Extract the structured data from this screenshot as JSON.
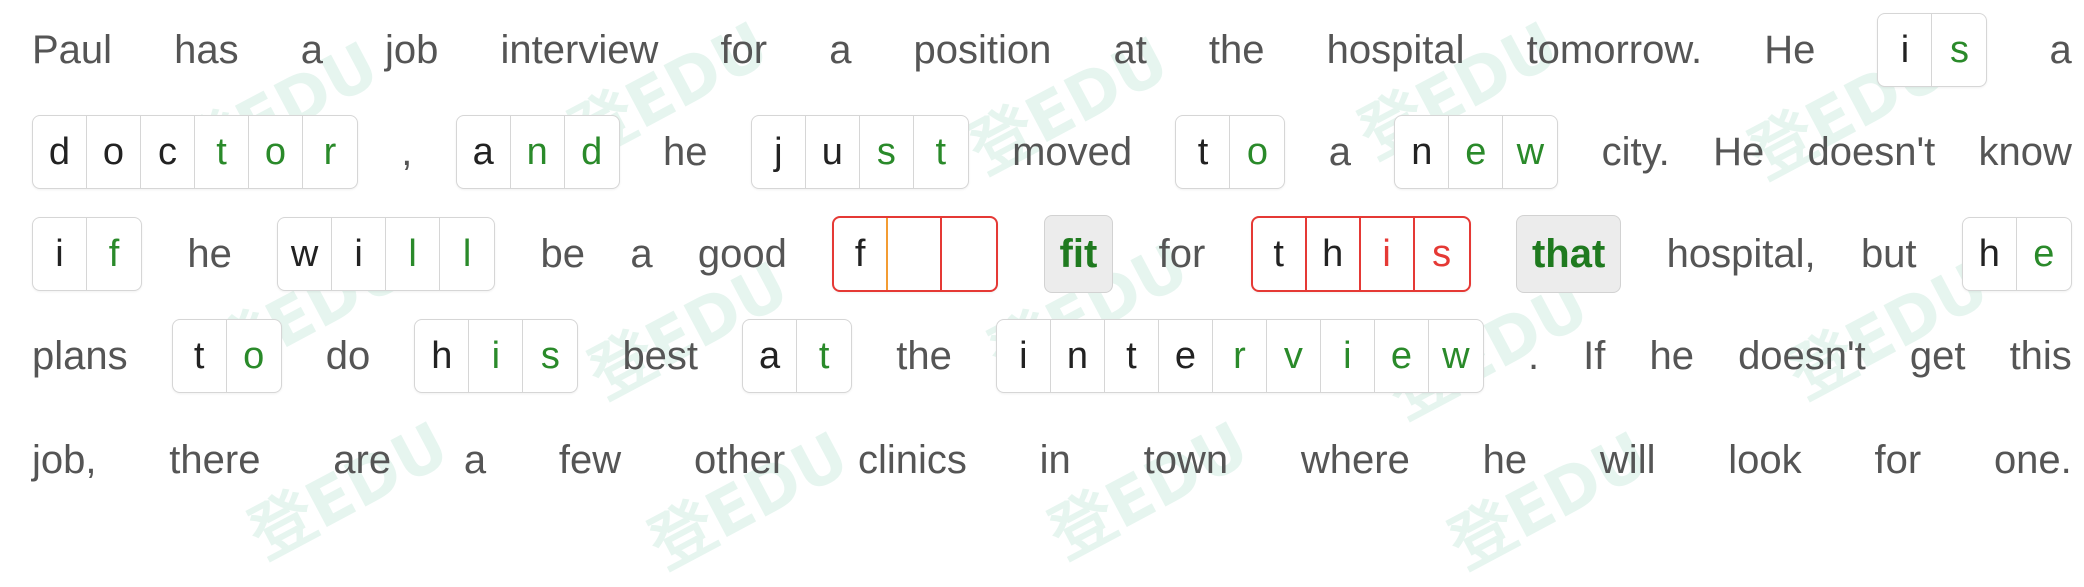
{
  "watermark_text": "登EDU",
  "lines": [
    [
      {
        "t": "word",
        "text": "Paul"
      },
      {
        "t": "word",
        "text": "has"
      },
      {
        "t": "word",
        "text": "a"
      },
      {
        "t": "word",
        "text": "job"
      },
      {
        "t": "word",
        "text": "interview"
      },
      {
        "t": "word",
        "text": "for"
      },
      {
        "t": "word",
        "text": "a"
      },
      {
        "t": "word",
        "text": "position"
      },
      {
        "t": "word",
        "text": "at"
      },
      {
        "t": "word",
        "text": "the"
      },
      {
        "t": "word",
        "text": "hospital"
      },
      {
        "t": "word",
        "text": "tomorrow."
      },
      {
        "t": "word",
        "text": "He"
      },
      {
        "t": "box",
        "status": "normal",
        "cells": [
          {
            "ch": "i",
            "kind": "given"
          },
          {
            "ch": "s",
            "kind": "filled"
          }
        ]
      },
      {
        "t": "word",
        "text": "a"
      }
    ],
    [
      {
        "t": "box",
        "status": "normal",
        "cells": [
          {
            "ch": "d",
            "kind": "given"
          },
          {
            "ch": "o",
            "kind": "given"
          },
          {
            "ch": "c",
            "kind": "given"
          },
          {
            "ch": "t",
            "kind": "filled"
          },
          {
            "ch": "o",
            "kind": "filled"
          },
          {
            "ch": "r",
            "kind": "filled"
          }
        ]
      },
      {
        "t": "word",
        "text": ","
      },
      {
        "t": "box",
        "status": "normal",
        "cells": [
          {
            "ch": "a",
            "kind": "given"
          },
          {
            "ch": "n",
            "kind": "filled"
          },
          {
            "ch": "d",
            "kind": "filled"
          }
        ]
      },
      {
        "t": "word",
        "text": "he"
      },
      {
        "t": "box",
        "status": "normal",
        "cells": [
          {
            "ch": "j",
            "kind": "given"
          },
          {
            "ch": "u",
            "kind": "given"
          },
          {
            "ch": "s",
            "kind": "filled"
          },
          {
            "ch": "t",
            "kind": "filled"
          }
        ]
      },
      {
        "t": "word",
        "text": "moved"
      },
      {
        "t": "box",
        "status": "normal",
        "cells": [
          {
            "ch": "t",
            "kind": "given"
          },
          {
            "ch": "o",
            "kind": "filled"
          }
        ]
      },
      {
        "t": "word",
        "text": "a"
      },
      {
        "t": "box",
        "status": "normal",
        "cells": [
          {
            "ch": "n",
            "kind": "given"
          },
          {
            "ch": "e",
            "kind": "filled"
          },
          {
            "ch": "w",
            "kind": "filled"
          }
        ]
      },
      {
        "t": "word",
        "text": "city."
      },
      {
        "t": "word",
        "text": "He"
      },
      {
        "t": "word",
        "text": "doesn't"
      },
      {
        "t": "word",
        "text": "know"
      }
    ],
    [
      {
        "t": "box",
        "status": "normal",
        "cells": [
          {
            "ch": "i",
            "kind": "given"
          },
          {
            "ch": "f",
            "kind": "filled"
          }
        ]
      },
      {
        "t": "word",
        "text": "he"
      },
      {
        "t": "box",
        "status": "normal",
        "cells": [
          {
            "ch": "w",
            "kind": "given"
          },
          {
            "ch": "i",
            "kind": "given"
          },
          {
            "ch": "l",
            "kind": "filled"
          },
          {
            "ch": "l",
            "kind": "filled"
          }
        ]
      },
      {
        "t": "word",
        "text": "be"
      },
      {
        "t": "word",
        "text": "a"
      },
      {
        "t": "word",
        "text": "good"
      },
      {
        "t": "box",
        "status": "current",
        "cells": [
          {
            "ch": "f",
            "kind": "given"
          },
          {
            "ch": "",
            "kind": "blank"
          },
          {
            "ch": "",
            "kind": "blank"
          }
        ]
      },
      {
        "t": "answer",
        "text": "fit"
      },
      {
        "t": "word",
        "text": "for"
      },
      {
        "t": "box",
        "status": "wrong",
        "cells": [
          {
            "ch": "t",
            "kind": "given"
          },
          {
            "ch": "h",
            "kind": "given"
          },
          {
            "ch": "i",
            "kind": "filled"
          },
          {
            "ch": "s",
            "kind": "filled"
          }
        ]
      },
      {
        "t": "answer",
        "text": "that"
      },
      {
        "t": "word",
        "text": "hospital,"
      },
      {
        "t": "word",
        "text": "but"
      },
      {
        "t": "box",
        "status": "normal",
        "cells": [
          {
            "ch": "h",
            "kind": "given"
          },
          {
            "ch": "e",
            "kind": "filled"
          }
        ]
      }
    ],
    [
      {
        "t": "word",
        "text": "plans"
      },
      {
        "t": "box",
        "status": "normal",
        "cells": [
          {
            "ch": "t",
            "kind": "given"
          },
          {
            "ch": "o",
            "kind": "filled"
          }
        ]
      },
      {
        "t": "word",
        "text": "do"
      },
      {
        "t": "box",
        "status": "normal",
        "cells": [
          {
            "ch": "h",
            "kind": "given"
          },
          {
            "ch": "i",
            "kind": "filled"
          },
          {
            "ch": "s",
            "kind": "filled"
          }
        ]
      },
      {
        "t": "word",
        "text": "best"
      },
      {
        "t": "box",
        "status": "normal",
        "cells": [
          {
            "ch": "a",
            "kind": "given"
          },
          {
            "ch": "t",
            "kind": "filled"
          }
        ]
      },
      {
        "t": "word",
        "text": "the"
      },
      {
        "t": "box",
        "status": "normal",
        "cells": [
          {
            "ch": "i",
            "kind": "given"
          },
          {
            "ch": "n",
            "kind": "given"
          },
          {
            "ch": "t",
            "kind": "given"
          },
          {
            "ch": "e",
            "kind": "given"
          },
          {
            "ch": "r",
            "kind": "filled"
          },
          {
            "ch": "v",
            "kind": "filled"
          },
          {
            "ch": "i",
            "kind": "filled"
          },
          {
            "ch": "e",
            "kind": "filled"
          },
          {
            "ch": "w",
            "kind": "filled"
          }
        ]
      },
      {
        "t": "word",
        "text": "."
      },
      {
        "t": "word",
        "text": "If"
      },
      {
        "t": "word",
        "text": "he"
      },
      {
        "t": "word",
        "text": "doesn't"
      },
      {
        "t": "word",
        "text": "get"
      },
      {
        "t": "word",
        "text": "this"
      }
    ],
    [
      {
        "t": "word",
        "text": "job,"
      },
      {
        "t": "word",
        "text": "there"
      },
      {
        "t": "word",
        "text": "are"
      },
      {
        "t": "word",
        "text": "a"
      },
      {
        "t": "word",
        "text": "few"
      },
      {
        "t": "word",
        "text": "other"
      },
      {
        "t": "word",
        "text": "clinics"
      },
      {
        "t": "word",
        "text": "in"
      },
      {
        "t": "word",
        "text": "town"
      },
      {
        "t": "word",
        "text": "where"
      },
      {
        "t": "word",
        "text": "he"
      },
      {
        "t": "word",
        "text": "will"
      },
      {
        "t": "word",
        "text": "look"
      },
      {
        "t": "word",
        "text": "for"
      },
      {
        "t": "word",
        "text": "one."
      }
    ]
  ]
}
